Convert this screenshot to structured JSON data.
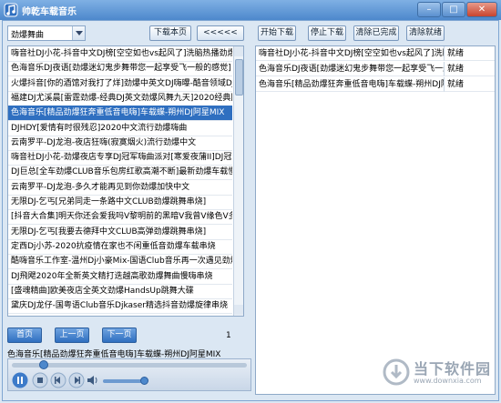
{
  "window": {
    "title": "帅乾车载音乐",
    "minimize": "–",
    "maximize": "□",
    "close": "✕"
  },
  "category_select": {
    "value": "劲爆舞曲"
  },
  "buttons": {
    "download_page": "下载本页",
    "back": "<<<<<",
    "start_download": "开始下载",
    "stop_download": "停止下载",
    "clear_done": "清除已完成",
    "clear_ready": "清除就绪",
    "first_page": "首页",
    "prev_page": "上一页",
    "next_page": "下一页"
  },
  "song_list": {
    "selected_index": 5,
    "items": [
      "嗨音社DJ小花-抖音中文DJ榜[空空如也vs起风了]洗脑热播劲爆中文",
      "色海音乐DJ夜语[劲爆迷幻鬼步舞带您一起享受飞一般的感觉]",
      "火爆抖音[你的酒馆对我打了烊]劲爆中英文DJ嗨曝-酷音领域DJ龙仔",
      "福建DJ尤溪晨[雷霆劲爆-经典DJ英文劲爆风舞九天]2020经典回味",
      "色海音乐[精品劲爆狂奔重低音电嗨]车载蝶-朔州DJ阿星MIX",
      "DJHDY[爱情有时很残忍]2020中文流行劲爆嗨曲",
      "云南罗平-DJ龙泡-夜店狂嗨(寂寞烟火)流行劲爆中文",
      "嗨音社DJ小花-劲爆夜店专享DJ冠军嗨曲派对[寒爱夜蒲II]DJ冠军嗨",
      "DJ巨总[全车劲爆CLUB音乐包房红歌高潮不断]最新劲爆车载慢摇串",
      "云南罗平-DJ龙泡-多久才能再见到你劲爆加快中文",
      "无限DJ-乞丐[兄弟同走一条路中文CLUB劲爆跳舞串烧]",
      "[抖音大合集]明天你还会爱我吗V黎明前的黑暗V我曾V缘色V多想在",
      "无限DJ-乞丐[我要去德拜中文CLUB高弹劲爆跳舞串烧]",
      "定西Dj小苏-2020抗疫情在家也不闲重低音劲爆车载串烧",
      "酷嗨音乐工作室-温州Dj小豪Mix-国语Club音乐再一次遇见劲爆超越",
      "DJ飛飔2020年全新英文精打迭越高歌劲爆舞曲慢嗨串烧",
      "[盛魂精曲]欧美夜店全英文劲爆HandsUp跳舞大碟",
      "黛庆DJ龙仔-国粤语Club音乐Djkaser精选抖音劲爆旋律串烧"
    ]
  },
  "download_queue": [
    {
      "name": "嗨音社DJ小花-抖音中文DJ榜[空空如也vs起风了]洗脑热",
      "status": "就绪"
    },
    {
      "name": "色海音乐DJ夜语[劲爆迷幻鬼步舞带您一起享受飞一般的",
      "status": "就绪"
    },
    {
      "name": "色海音乐[精品劲爆狂奔重低音电嗨]车载蝶-朔州DJ阿星",
      "status": "就绪"
    }
  ],
  "page_number": "1",
  "now_playing": "色海音乐[精品劲爆狂奔重低音电嗨]车载蝶-朔州DJ阿星MIX",
  "player": {
    "progress": 0.12,
    "volume": 0.95
  },
  "watermark": {
    "text": "当下软件园",
    "sub": "www.downxia.com"
  }
}
